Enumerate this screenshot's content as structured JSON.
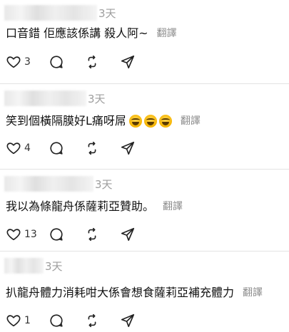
{
  "comments": [
    {
      "time": "3天",
      "text": "口音錯 佢應該係講 殺人阿~",
      "translate": "翻譯",
      "likes": "3",
      "emoji_count": 0
    },
    {
      "time": "3天",
      "text": "笑到個橫隔膜好L痛呀屌",
      "translate": "翻譯",
      "likes": "4",
      "emoji_count": 3
    },
    {
      "time": "3天",
      "text": "我以為條龍舟係薩莉亞贊助。",
      "translate": "翻譯",
      "likes": "13",
      "emoji_count": 0
    },
    {
      "time": "3天",
      "text": "扒龍舟體力消耗咁大係會想食薩莉亞補充體力",
      "translate": "翻譯",
      "likes": "1",
      "emoji_count": 0
    }
  ],
  "icons": {
    "like": "heart-icon",
    "reply": "comment-icon",
    "repost": "repost-icon",
    "share": "send-icon",
    "emoji": "face-with-tears-of-joy"
  }
}
